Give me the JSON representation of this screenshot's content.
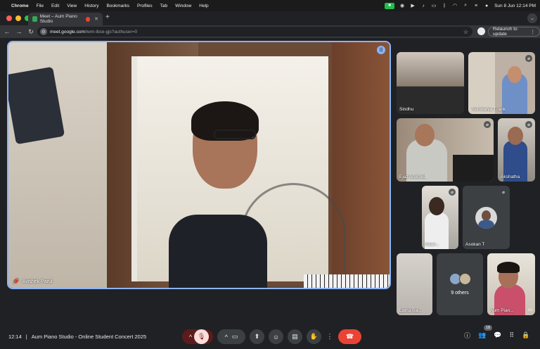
{
  "menubar": {
    "app": "Chrome",
    "items": [
      "File",
      "Edit",
      "View",
      "History",
      "Bookmarks",
      "Profiles",
      "Tab",
      "Window",
      "Help"
    ],
    "clock": "Sun 8 Jun  12:14 PM"
  },
  "browser": {
    "tab_title": "Meet – Aum Piano Studio",
    "url_host": "meet.google.com",
    "url_path": "/iwm-ibce-gjs?authuser=0",
    "relaunch_label": "Relaunch to update"
  },
  "meet": {
    "main_speaker": "Avishek Parui",
    "participants": [
      {
        "name": "Sindhu"
      },
      {
        "name": "Aishwarya T..ank"
      },
      {
        "name": "Ejaz Ahamed"
      },
      {
        "name": "Akshatha"
      },
      {
        "name": "Ivaan..."
      },
      {
        "name": "Asokan T"
      },
      {
        "name": "Latha Bal..."
      },
      {
        "name": "Aum Pian..."
      }
    ],
    "others_label": "9 others",
    "time": "12:14",
    "separator": "|",
    "meeting_title": "Aum Piano Studio - Online Student Concert 2025",
    "participant_count": "18"
  },
  "colors": {
    "accent": "#8ab4f8",
    "leave": "#ea4335",
    "mic_off_bg": "#f9dedc"
  }
}
